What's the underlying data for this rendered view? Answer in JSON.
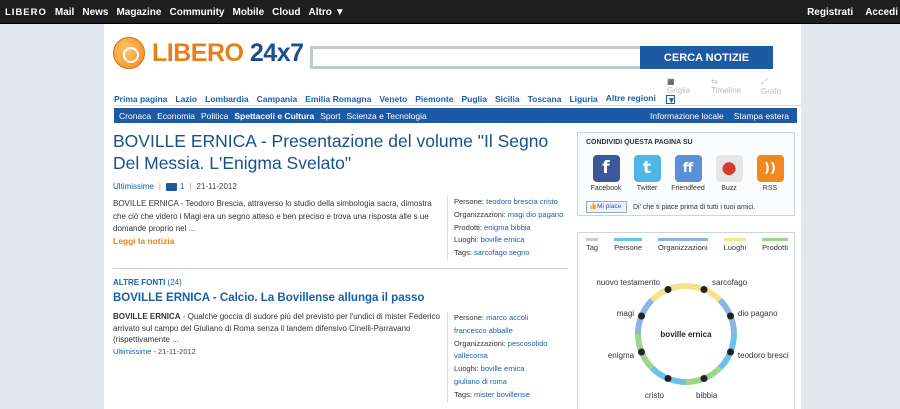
{
  "topbar": {
    "items": [
      "LIBERO",
      "Mail",
      "News",
      "Magazine",
      "Community",
      "Mobile",
      "Cloud",
      "Altro"
    ],
    "right": [
      "Registrati",
      "Accedi"
    ]
  },
  "header": {
    "logo_a": "LIBERO",
    "logo_b": "24x7",
    "search_placeholder": "",
    "search_button": "CERCA NOTIZIE",
    "views": [
      "Griglia",
      "Timeline",
      "Grafo"
    ]
  },
  "regions": [
    "Prima pagina",
    "Lazio",
    "Lombardia",
    "Campania",
    "Emilia Romagna",
    "Veneto",
    "Piemonte",
    "Puglia",
    "Sicilia",
    "Toscana",
    "Liguria",
    "Altre regioni"
  ],
  "categories": [
    "Cronaca",
    "Economia",
    "Politica",
    "Spettacoli e Cultura",
    "Sport",
    "Scienza e Tecnologia"
  ],
  "category_right": [
    "Informazione locale",
    "Stampa estera"
  ],
  "article": {
    "title": "BOVILLE ERNICA - Presentazione del volume \"Il Segno Del Messia. L'Enigma Svelato\"",
    "source": "Ultimissime",
    "photos": "1",
    "date": "21-11-2012",
    "summary": "BOVILLE ERNICA - Teodoro Brescia, attraverso lo studio della simbologia sacra, dimostra che ciò che videro i Magi era un segno atteso e ben preciso e trova una risposta alle s ue domande proprio nel ...",
    "read_more": "Leggi la notizia",
    "tags": [
      {
        "k": "Persone:",
        "v": "teodoro brescia cristo"
      },
      {
        "k": "Organizzazioni:",
        "v": "magi dio pagano"
      },
      {
        "k": "Prodotti:",
        "v": "enigma bibbia"
      },
      {
        "k": "Luoghi:",
        "v": "boville ernica"
      },
      {
        "k": "Tags:",
        "v": "sarcofago segno"
      }
    ]
  },
  "other": {
    "label": "ALTRE FONTI",
    "count": "(24)",
    "title": "BOVILLE ERNICA - Calcio. La Bovillense allunga il passo",
    "lead": "BOVILLE ERNICA",
    "summary": " - Qualche goccia di sudore più del previsto per l'undici di mister Federico arrivato sul campo del Giuliano di Roma senza il tandem difensivo Cinelli-Parravano (rispettivamente ...",
    "source": "Ultimissime",
    "date": "21-11-2012",
    "tags": [
      {
        "k": "Persone:",
        "v": "marco accoli"
      },
      {
        "k": "",
        "v": "francesco abballe"
      },
      {
        "k": "Organizzazioni:",
        "v": "pescosolido"
      },
      {
        "k": "",
        "v": "vallecorsa"
      },
      {
        "k": "Luoghi:",
        "v": "boville ernica"
      },
      {
        "k": "",
        "v": "giuliano di roma"
      },
      {
        "k": "Tags:",
        "v": "mister bovillense"
      }
    ]
  },
  "share": {
    "title": "CONDIVIDI QUESTA PAGINA SU",
    "items": [
      {
        "label": "Facebook",
        "glyph": "f",
        "color": "#3b5998"
      },
      {
        "label": "Twitter",
        "glyph": "t",
        "color": "#4fb4e6"
      },
      {
        "label": "Friendfeed",
        "glyph": "ff",
        "color": "#5b8fd6"
      },
      {
        "label": "Buzz",
        "glyph": "●",
        "color": "#d9d9d9"
      },
      {
        "label": "RSS",
        "glyph": "))",
        "color": "#f0881e"
      }
    ],
    "like_button": "Mi piace",
    "like_text": "Di' che ti piace prima di tutti i tuoi amici."
  },
  "tagcloud": {
    "tabs": [
      {
        "label": "Tag",
        "color": "#cccccc"
      },
      {
        "label": "Persone",
        "color": "#6cc1e8"
      },
      {
        "label": "Organizzazioni",
        "color": "#8db4e2"
      },
      {
        "label": "Luoghi",
        "color": "#f3e48a"
      },
      {
        "label": "Prodotti",
        "color": "#9bd68a"
      }
    ],
    "center": "boville ernica",
    "nodes": [
      "nuovo testamento",
      "sarcofago",
      "dio pagano",
      "teodoro bresci",
      "bibbia",
      "cristo",
      "enigma",
      "magi"
    ]
  }
}
